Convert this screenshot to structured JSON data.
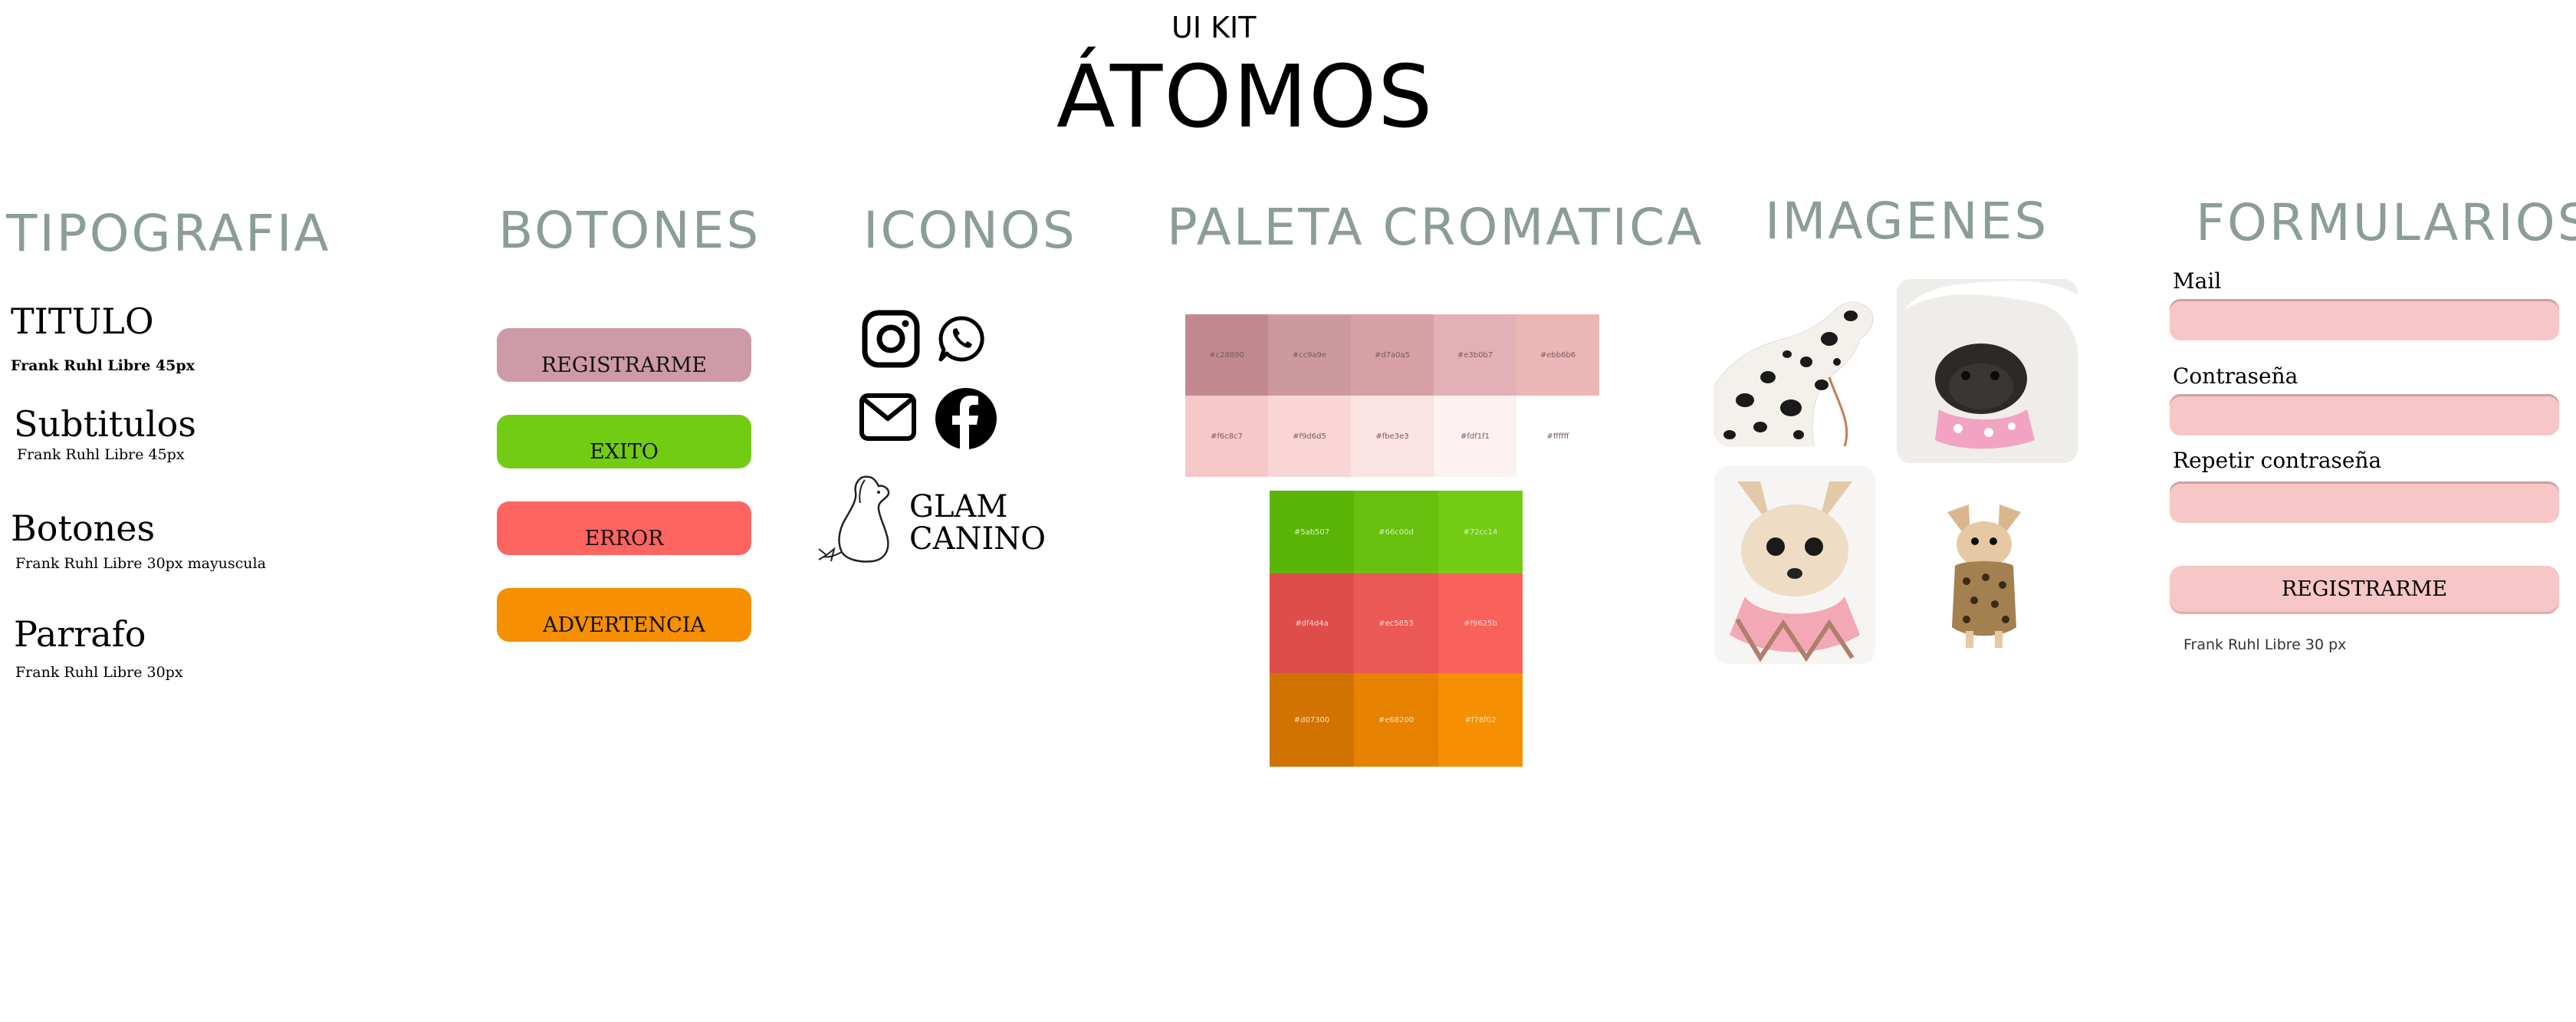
{
  "header": {
    "kit": "UI KIT",
    "title": "ÁTOMOS"
  },
  "sections": {
    "typography": "TIPOGRAFIA",
    "buttons": "BOTONES",
    "icons": "ICONOS",
    "palette": "PALETA CROMATICA",
    "images": "IMAGENES",
    "forms": "FORMULARIOS"
  },
  "typography": {
    "title": "TITULO",
    "title_spec": "Frank Ruhl Libre 45px",
    "subtitles": "Subtitulos",
    "subtitles_spec": "Frank Ruhl Libre 45px",
    "buttons": "Botones",
    "buttons_spec": "Frank Ruhl Libre 30px mayuscula",
    "paragraph": "Parrafo",
    "paragraph_spec": "Frank Ruhl Libre 30px"
  },
  "buttons": [
    {
      "label": "REGISTRARME",
      "color": "#cf9aa8"
    },
    {
      "label": "EXITO",
      "color": "#72cc14"
    },
    {
      "label": "ERROR",
      "color": "#fe6560"
    },
    {
      "label": "ADVERTENCIA",
      "color": "#f68f02"
    }
  ],
  "icons": [
    "instagram-icon",
    "whatsapp-icon",
    "mail-icon",
    "facebook-icon"
  ],
  "logo": {
    "line1": "GLAM",
    "line2": "CANINO"
  },
  "palette": {
    "pinks_row1": [
      {
        "hex": "#c28890",
        "color": "#c28890",
        "text": "#7a5a5f"
      },
      {
        "hex": "#cc9a9e",
        "color": "#cc9a9e",
        "text": "#7a5a5f"
      },
      {
        "hex": "#d7a0a5",
        "color": "#d7a0a5",
        "text": "#7a5a5f"
      },
      {
        "hex": "#e3b0b7",
        "color": "#e3b0b7",
        "text": "#7a5a5f"
      },
      {
        "hex": "#ebb6b6",
        "color": "#ebb6b6",
        "text": "#7a5a5f"
      }
    ],
    "pinks_row2": [
      {
        "hex": "#f6c8c7",
        "color": "#f6c8c7",
        "text": "#7a5a5f"
      },
      {
        "hex": "#f9d6d5",
        "color": "#f9d6d5",
        "text": "#7a5a5f"
      },
      {
        "hex": "#fbe3e3",
        "color": "#fbe3e3",
        "text": "#7a5a5f"
      },
      {
        "hex": "#fdf1f1",
        "color": "#fdf1f1",
        "text": "#7a5a5f"
      },
      {
        "hex": "#ffffff",
        "color": "#ffffff",
        "text": "#7a5a5f"
      }
    ],
    "greens": [
      {
        "hex": "#5ab507",
        "color": "#5ab507",
        "text": "#d6f2bd"
      },
      {
        "hex": "#66c00d",
        "color": "#66c00d",
        "text": "#d6f2bd"
      },
      {
        "hex": "#72cc14",
        "color": "#72cc14",
        "text": "#d6f2bd"
      }
    ],
    "reds": [
      {
        "hex": "#df4d4a",
        "color": "#df4d4a",
        "text": "#ffd7d6"
      },
      {
        "hex": "#ec5853",
        "color": "#ec5853",
        "text": "#ffd7d6"
      },
      {
        "hex": "#f9625b",
        "color": "#f9625b",
        "text": "#ffd7d6"
      }
    ],
    "oranges": [
      {
        "hex": "#d07300",
        "color": "#d07300",
        "text": "#ffe2bb"
      },
      {
        "hex": "#e68200",
        "color": "#e68200",
        "text": "#ffe2bb"
      },
      {
        "hex": "#f78f02",
        "color": "#f78f02",
        "text": "#ffe2bb"
      }
    ]
  },
  "images": [
    "dalmatian-photo",
    "pug-photo",
    "chihuahua-photo",
    "leopard-coat-chihuahua-photo"
  ],
  "forms": {
    "mail_label": "Mail",
    "password_label": "Contraseña",
    "repeat_label": "Repetir contraseña",
    "submit_label": "REGISTRARME",
    "spec": "Frank Ruhl Libre 30 px"
  }
}
